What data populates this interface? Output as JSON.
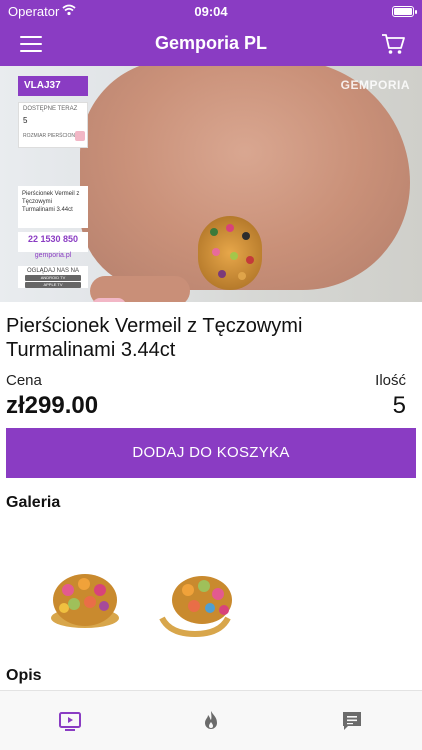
{
  "status_bar": {
    "carrier": "Operator",
    "time": "09:04"
  },
  "nav": {
    "title": "Gemporia PL"
  },
  "video": {
    "brand_watermark": "GEMPORIA",
    "panel": {
      "code": "VLAJ37",
      "available_label": "DOSTĘPNE TERAZ",
      "available_value": "5",
      "size_label": "ROZMIAR PIERŚCIONKA",
      "description": "Pierścionek Vermeil z Tęczowymi Turmalinami 3.44ct",
      "phone": "22 1530 850",
      "url": "gemporia.pl",
      "watch_label": "OGLĄDAJ NAS NA",
      "watch_android": "ANDROID TV",
      "watch_apple": "APPLE TV"
    }
  },
  "product": {
    "title": "Pierścionek Vermeil z Tęczowymi Turmalinami 3.44ct",
    "price_label": "Cena",
    "price": "zł299.00",
    "quantity_label": "Ilość",
    "quantity": "5",
    "add_to_cart": "DODAJ DO KOSZYKA"
  },
  "gallery": {
    "title": "Galeria",
    "items": [
      "ring-front-view",
      "ring-side-view"
    ]
  },
  "description": {
    "title": "Opis"
  },
  "tabbar": {
    "tabs": [
      {
        "icon": "tv-play-icon",
        "active": true
      },
      {
        "icon": "flame-icon",
        "active": false
      },
      {
        "icon": "chat-icon",
        "active": false
      }
    ]
  },
  "colors": {
    "brand": "#8a3cc3",
    "tab_inactive": "#6b6b6b"
  }
}
